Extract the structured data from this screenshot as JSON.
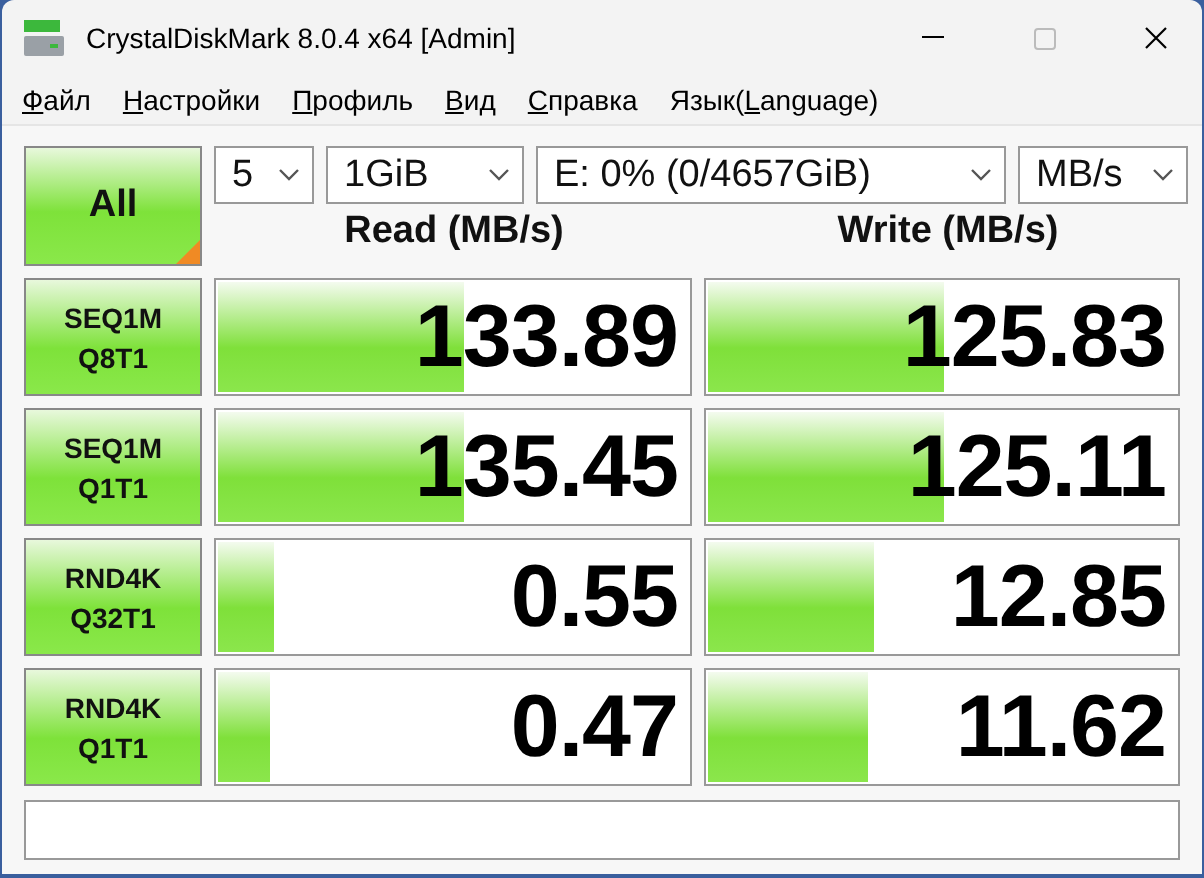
{
  "window": {
    "title": "CrystalDiskMark 8.0.4 x64 [Admin]"
  },
  "menu": [
    {
      "key": "Ф",
      "after": "айл"
    },
    {
      "key": "Н",
      "after": "астройки"
    },
    {
      "key": "П",
      "after": "рофиль"
    },
    {
      "key": "В",
      "after": "ид"
    },
    {
      "key": "С",
      "after": "правка"
    },
    {
      "before": "Язык(",
      "key": "L",
      "after": "anguage)"
    }
  ],
  "controls": {
    "all_button": "All",
    "count": "5",
    "size": "1GiB",
    "drive": "E: 0% (0/4657GiB)",
    "unit": "MB/s"
  },
  "headers": {
    "read": "Read (MB/s)",
    "write": "Write (MB/s)"
  },
  "tests": [
    {
      "line1": "SEQ1M",
      "line2": "Q8T1",
      "read": {
        "value": "133.89",
        "level": 0.52
      },
      "write": {
        "value": "125.83",
        "level": 0.5
      }
    },
    {
      "line1": "SEQ1M",
      "line2": "Q1T1",
      "read": {
        "value": "135.45",
        "level": 0.52
      },
      "write": {
        "value": "125.11",
        "level": 0.5
      }
    },
    {
      "line1": "RND4K",
      "line2": "Q32T1",
      "read": {
        "value": "0.55",
        "level": 0.12
      },
      "write": {
        "value": "12.85",
        "level": 0.35
      }
    },
    {
      "line1": "RND4K",
      "line2": "Q1T1",
      "read": {
        "value": "0.47",
        "level": 0.11
      },
      "write": {
        "value": "11.62",
        "level": 0.34
      }
    }
  ]
}
